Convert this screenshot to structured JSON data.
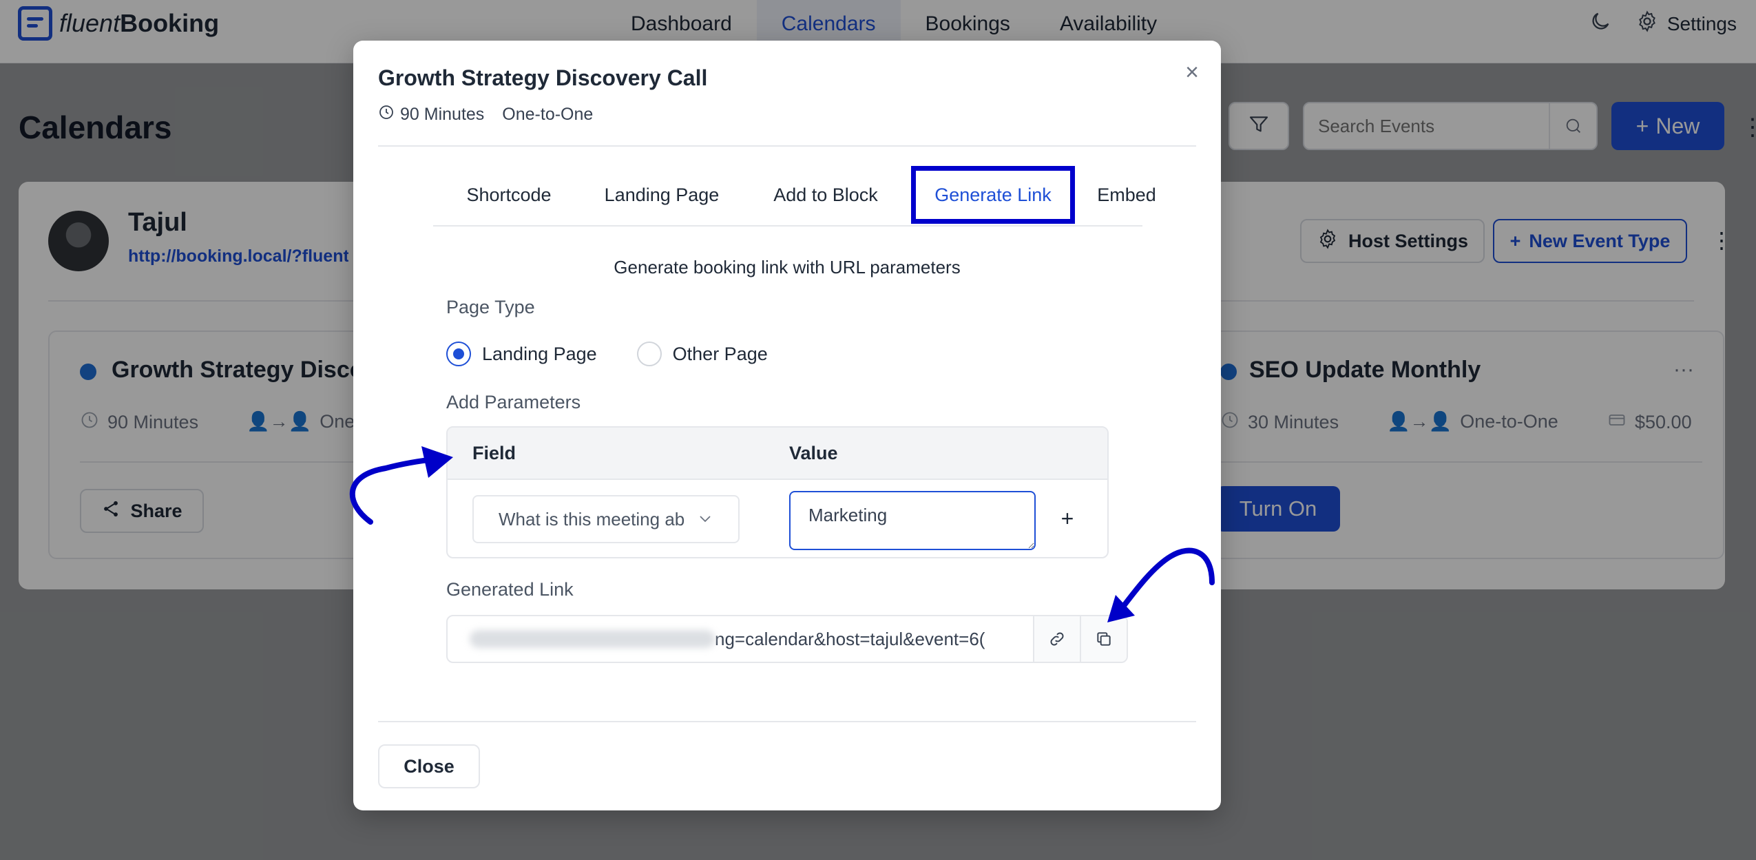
{
  "app": {
    "logo_light": "fluent",
    "logo_bold": "Booking",
    "nav": [
      "Dashboard",
      "Calendars",
      "Bookings",
      "Availability"
    ],
    "active_nav": "Calendars",
    "settings_label": "Settings",
    "icons": {
      "theme": "moon-icon",
      "settings": "gear-icon"
    }
  },
  "page": {
    "title": "Calendars",
    "search_placeholder": "Search Events",
    "new_label": "New"
  },
  "host": {
    "name": "Tajul",
    "url": "http://booking.local/?fluent-b",
    "host_settings_label": "Host Settings",
    "new_event_type_label": "New Event Type"
  },
  "events": [
    {
      "title": "Growth Strategy Discov",
      "duration": "90 Minutes",
      "type": "One",
      "share_label": "Share"
    },
    {
      "title": "SEO Update Monthly",
      "duration": "30 Minutes",
      "type": "One-to-One",
      "price": "$50.00",
      "turn_on_label": "Turn On"
    }
  ],
  "modal": {
    "title": "Growth Strategy Discovery Call",
    "duration": "90 Minutes",
    "meeting_type": "One-to-One",
    "tabs": [
      "Shortcode",
      "Landing Page",
      "Add to Block",
      "Generate Link",
      "Embed"
    ],
    "active_tab": "Generate Link",
    "subtitle": "Generate booking link with URL parameters",
    "page_type_label": "Page Type",
    "page_type_options": [
      "Landing Page",
      "Other Page"
    ],
    "page_type_selected": "Landing Page",
    "add_parameters_label": "Add Parameters",
    "table": {
      "field_header": "Field",
      "value_header": "Value",
      "field_value": "What is this meeting ab",
      "value_value": "Marketing",
      "add_symbol": "+"
    },
    "generated_link_label": "Generated Link",
    "generated_link_visible": "ng=calendar&host=tajul&event=6(",
    "close_label": "Close"
  },
  "colors": {
    "accent": "#1e4fd6",
    "highlight_box": "#0000cc",
    "annotation_arrow": "#0000c8"
  }
}
